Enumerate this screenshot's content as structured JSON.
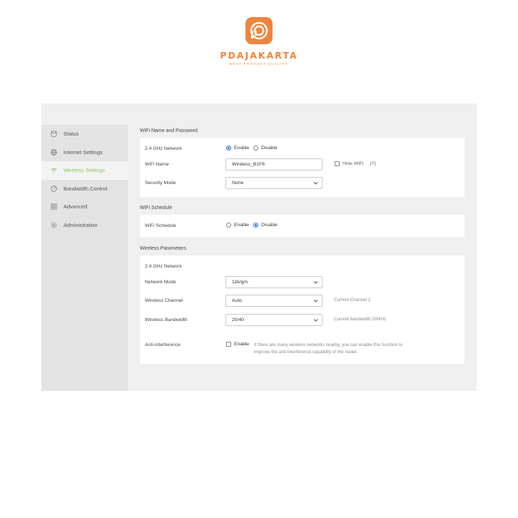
{
  "brand": {
    "name": "PDAJAKARTA",
    "tagline": "BEST PRODUCT QUALITY",
    "color": "#f0843c"
  },
  "sidebar": {
    "items": [
      {
        "label": "Status",
        "icon": "status-icon"
      },
      {
        "label": "Internet Settings",
        "icon": "globe-icon"
      },
      {
        "label": "Wireless Settings",
        "icon": "wifi-icon",
        "active": true
      },
      {
        "label": "Bandwidth Control",
        "icon": "gauge-icon"
      },
      {
        "label": "Advanced",
        "icon": "grid-icon"
      },
      {
        "label": "Administration",
        "icon": "gear-icon"
      }
    ],
    "active_color": "#8cc265"
  },
  "wifi_name_password": {
    "title": "WiFi Name and Password",
    "network_label": "2.4 GHz Network",
    "enable_label": "Enable",
    "disable_label": "Disable",
    "network_state": "Enable",
    "wifi_name_label": "WiFi Name",
    "wifi_name_value": "Wireless_B1F6",
    "hide_wifi_label": "Hide WiFi",
    "hide_wifi_help": "(?)",
    "hide_wifi_checked": false,
    "security_mode_label": "Security Mode",
    "security_mode_value": "None"
  },
  "wifi_schedule": {
    "title": "WiFi Schedule",
    "label": "WiFi Schedule",
    "enable_label": "Enable",
    "disable_label": "Disable",
    "state": "Disable"
  },
  "wireless_parameters": {
    "title": "Wireless Parameters",
    "network_label": "2.4 GHz Network",
    "network_mode_label": "Network Mode",
    "network_mode_value": "11b/g/n",
    "channel_label": "Wireless Channel",
    "channel_value": "Auto",
    "current_channel": "Current Channel:1",
    "bandwidth_label": "Wireless Bandwidth",
    "bandwidth_value": "20/40",
    "current_bandwidth": "Current bandwidth:20MHz",
    "anti_interference_label": "Anti-interference",
    "anti_interference_enable": "Enable",
    "anti_interference_checked": false,
    "anti_interference_hint_1": "If there are many wireless networks nearby, you can enable this function to",
    "anti_interference_hint_2": "improve the anti-interference capability of the router."
  },
  "colors": {
    "radio_selected": "#2f73e0",
    "background": "#efefef",
    "sidebar": "#e3e3e3"
  }
}
